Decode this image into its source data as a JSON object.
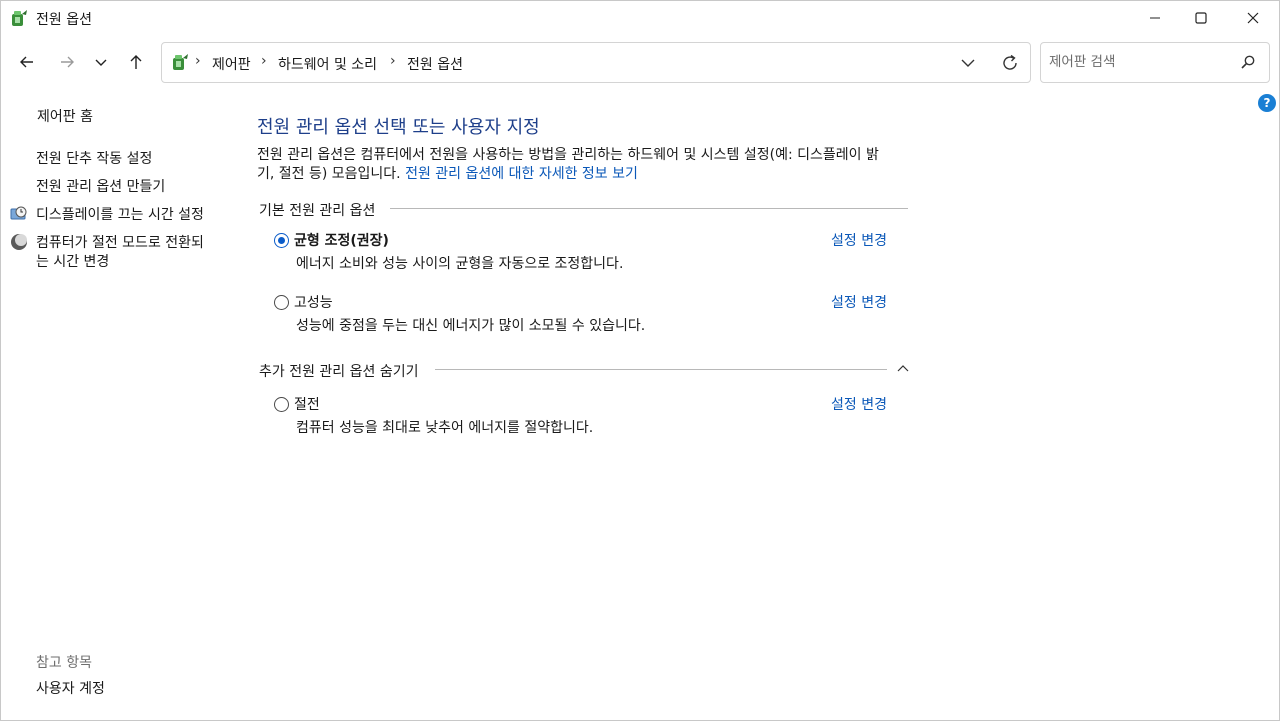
{
  "window": {
    "title": "전원 옵션",
    "controls": {
      "minimize": "—",
      "maximize": "☐",
      "close": "✕"
    }
  },
  "nav": {
    "back_icon": "arrow-left",
    "forward_icon": "arrow-right",
    "recent_icon": "chevron-down",
    "up_icon": "arrow-up"
  },
  "address": {
    "sep": "›",
    "crumbs": [
      "제어판",
      "하드웨어 및 소리",
      "전원 옵션"
    ]
  },
  "search": {
    "placeholder": "제어판 검색"
  },
  "help": {
    "label": "?"
  },
  "sidebar": {
    "home": "제어판 홈",
    "links": [
      "전원 단추 작동 설정",
      "전원 관리 옵션 만들기",
      "디스플레이를 끄는 시간 설정",
      "컴퓨터가 절전 모드로 전환되",
      "는 시간 변경"
    ],
    "see_also_title": "참고 항목",
    "see_also": [
      "사용자 계정"
    ]
  },
  "main": {
    "title": "전원 관리 옵션 선택 또는 사용자 지정",
    "desc_line1": "전원 관리 옵션은 컴퓨터에서 전원을 사용하는 방법을 관리하는 하드웨어 및 시스템 설정(예: 디스플레이 밝",
    "desc_line2": "기, 절전 등) 모음입니다. ",
    "desc_link": "전원 관리 옵션에 대한 자세한 정보 보기",
    "group_basic": "기본 전원 관리 옵션",
    "group_extra": "추가 전원 관리 옵션 숨기기",
    "change_label": "설정 변경",
    "plans": [
      {
        "name": "균형 조정(권장)",
        "desc": "에너지 소비와 성능 사이의 균형을 자동으로 조정합니다.",
        "selected": true
      },
      {
        "name": "고성능",
        "desc": "성능에 중점을 두는 대신 에너지가 많이 소모될 수 있습니다.",
        "selected": false
      },
      {
        "name": "절전",
        "desc": "컴퓨터 성능을 최대로 낮추어 에너지를 절약합니다.",
        "selected": false
      }
    ]
  },
  "colors": {
    "title_blue": "#1e3f8a",
    "link_blue": "#0b58b8",
    "radio_blue": "#0b5cc9"
  }
}
